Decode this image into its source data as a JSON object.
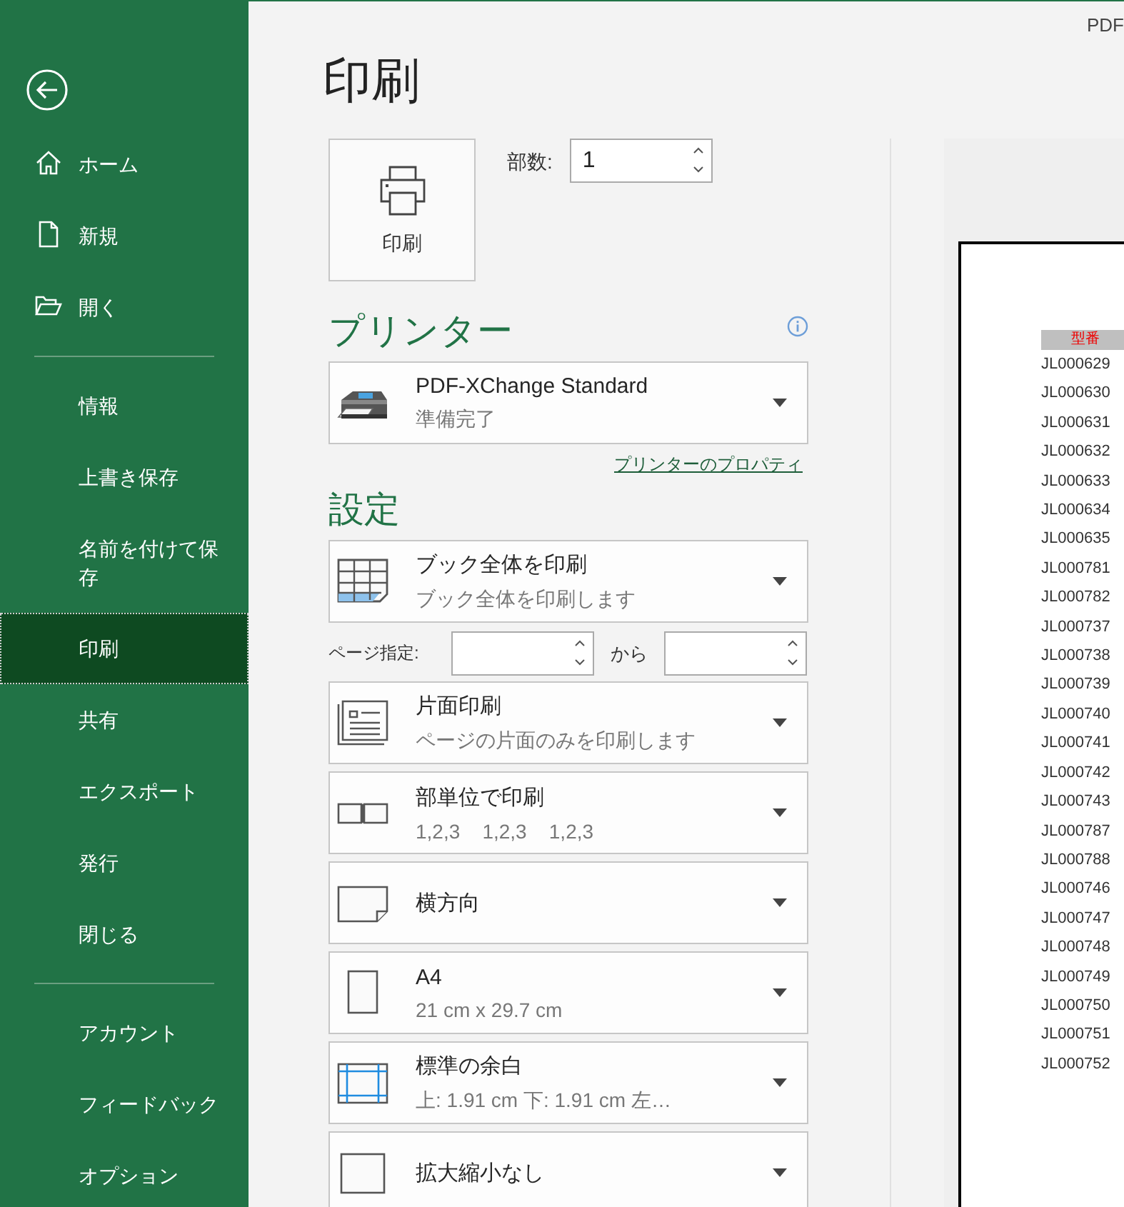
{
  "window": {
    "title": "PDF"
  },
  "sidebar": {
    "sections": [
      {
        "items": [
          {
            "label": "ホーム",
            "kind": "home",
            "selected": false
          },
          {
            "label": "新規",
            "kind": "new",
            "selected": false
          },
          {
            "label": "開く",
            "kind": "open",
            "selected": false
          }
        ]
      },
      {
        "items": [
          {
            "label": "情報",
            "kind": "plain",
            "selected": false
          },
          {
            "label": "上書き保存",
            "kind": "plain",
            "selected": false
          },
          {
            "label": "名前を付けて保存",
            "kind": "plain",
            "selected": false
          },
          {
            "label": "印刷",
            "kind": "plain",
            "selected": true
          },
          {
            "label": "共有",
            "kind": "plain",
            "selected": false
          },
          {
            "label": "エクスポート",
            "kind": "plain",
            "selected": false
          },
          {
            "label": "発行",
            "kind": "plain",
            "selected": false
          },
          {
            "label": "閉じる",
            "kind": "plain",
            "selected": false
          }
        ]
      },
      {
        "items": [
          {
            "label": "アカウント",
            "kind": "plain",
            "selected": false
          },
          {
            "label": "フィードバック",
            "kind": "plain",
            "selected": false
          },
          {
            "label": "オプション",
            "kind": "plain",
            "selected": false
          }
        ]
      }
    ]
  },
  "page_title": "印刷",
  "print_button": {
    "label": "印刷"
  },
  "copies": {
    "label": "部数:",
    "value": "1"
  },
  "printer": {
    "heading": "プリンター",
    "name": "PDF-XChange Standard",
    "status": "準備完了",
    "properties_link": "プリンターのプロパティ"
  },
  "settings": {
    "heading": "設定",
    "scope": {
      "title": "ブック全体を印刷",
      "subtitle": "ブック全体を印刷します"
    },
    "page_range": {
      "label": "ページ指定:",
      "to_label": "から"
    },
    "options": [
      {
        "title": "片面印刷",
        "subtitle": "ページの片面のみを印刷します"
      },
      {
        "title": "部単位で印刷",
        "subtitle": "1,2,3    1,2,3    1,2,3"
      },
      {
        "title": "横方向"
      },
      {
        "title": "A4",
        "subtitle": "21 cm x 29.7 cm"
      },
      {
        "title": "標準の余白",
        "subtitle": "上: 1.91 cm 下: 1.91 cm 左…"
      },
      {
        "title": "拡大縮小なし"
      }
    ]
  },
  "preview": {
    "column_header": "型番",
    "rows": [
      "JL000629",
      "JL000630",
      "JL000631",
      "JL000632",
      "JL000633",
      "JL000634",
      "JL000635",
      "JL000781",
      "JL000782",
      "JL000737",
      "JL000738",
      "JL000739",
      "JL000740",
      "JL000741",
      "JL000742",
      "JL000743",
      "JL000787",
      "JL000788",
      "JL000746",
      "JL000747",
      "JL000748",
      "JL000749",
      "JL000750",
      "JL000751",
      "JL000752"
    ]
  }
}
